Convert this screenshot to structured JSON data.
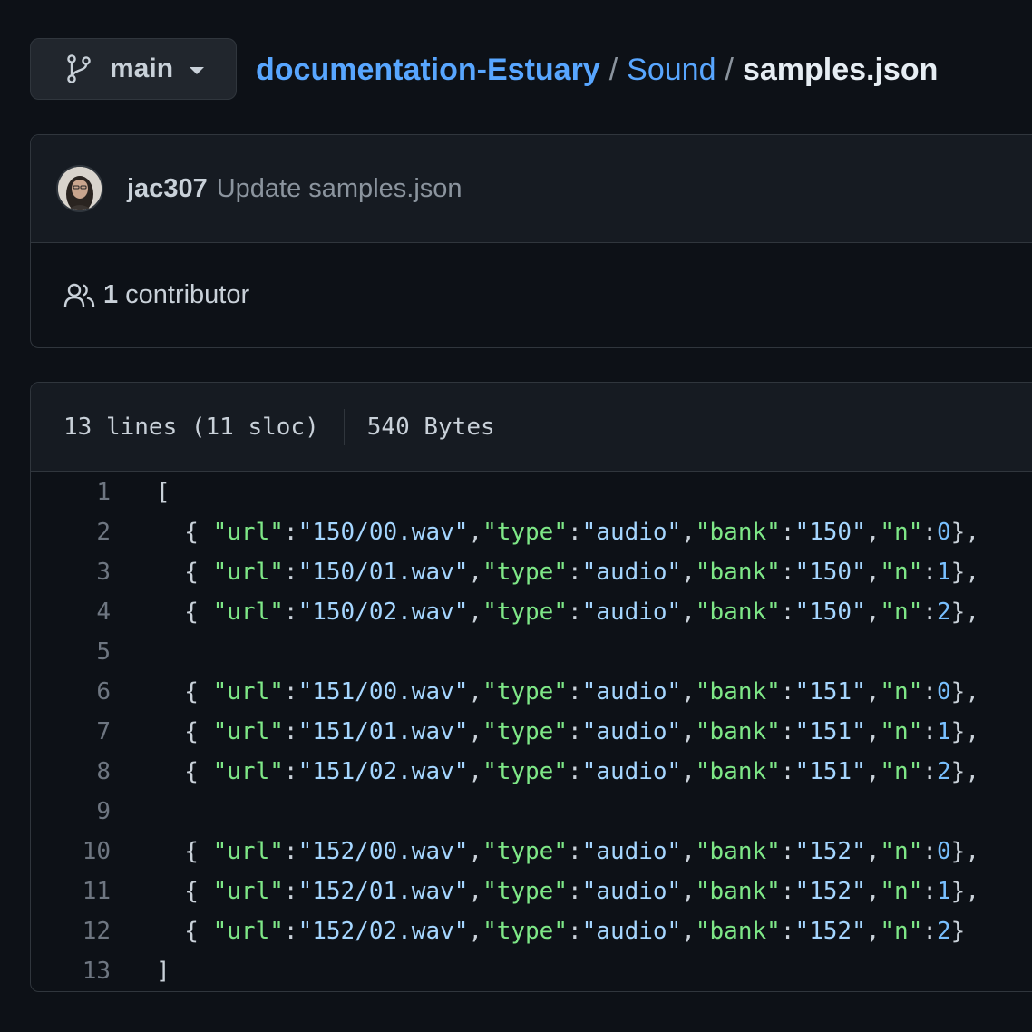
{
  "branch": {
    "name": "main",
    "icon": "git-branch-icon"
  },
  "breadcrumb": {
    "repo": "documentation-Estuary",
    "folder": "Sound",
    "file": "samples.json",
    "separator": "/"
  },
  "commit": {
    "author": "jac307",
    "message": "Update samples.json"
  },
  "contributors": {
    "count": "1",
    "label": "contributor"
  },
  "file_info": {
    "lines": "13 lines (11 sloc)",
    "size": "540 Bytes"
  },
  "code_lines": [
    {
      "num": "1",
      "tokens": [
        {
          "t": "p",
          "v": "["
        }
      ]
    },
    {
      "num": "2",
      "tokens": [
        {
          "t": "p",
          "v": "  { "
        },
        {
          "t": "k",
          "v": "\"url\""
        },
        {
          "t": "p",
          "v": ":"
        },
        {
          "t": "s",
          "v": "\"150/00.wav\""
        },
        {
          "t": "p",
          "v": ","
        },
        {
          "t": "k",
          "v": "\"type\""
        },
        {
          "t": "p",
          "v": ":"
        },
        {
          "t": "s",
          "v": "\"audio\""
        },
        {
          "t": "p",
          "v": ","
        },
        {
          "t": "k",
          "v": "\"bank\""
        },
        {
          "t": "p",
          "v": ":"
        },
        {
          "t": "s",
          "v": "\"150\""
        },
        {
          "t": "p",
          "v": ","
        },
        {
          "t": "k",
          "v": "\"n\""
        },
        {
          "t": "p",
          "v": ":"
        },
        {
          "t": "n",
          "v": "0"
        },
        {
          "t": "p",
          "v": "},"
        }
      ]
    },
    {
      "num": "3",
      "tokens": [
        {
          "t": "p",
          "v": "  { "
        },
        {
          "t": "k",
          "v": "\"url\""
        },
        {
          "t": "p",
          "v": ":"
        },
        {
          "t": "s",
          "v": "\"150/01.wav\""
        },
        {
          "t": "p",
          "v": ","
        },
        {
          "t": "k",
          "v": "\"type\""
        },
        {
          "t": "p",
          "v": ":"
        },
        {
          "t": "s",
          "v": "\"audio\""
        },
        {
          "t": "p",
          "v": ","
        },
        {
          "t": "k",
          "v": "\"bank\""
        },
        {
          "t": "p",
          "v": ":"
        },
        {
          "t": "s",
          "v": "\"150\""
        },
        {
          "t": "p",
          "v": ","
        },
        {
          "t": "k",
          "v": "\"n\""
        },
        {
          "t": "p",
          "v": ":"
        },
        {
          "t": "n",
          "v": "1"
        },
        {
          "t": "p",
          "v": "},"
        }
      ]
    },
    {
      "num": "4",
      "tokens": [
        {
          "t": "p",
          "v": "  { "
        },
        {
          "t": "k",
          "v": "\"url\""
        },
        {
          "t": "p",
          "v": ":"
        },
        {
          "t": "s",
          "v": "\"150/02.wav\""
        },
        {
          "t": "p",
          "v": ","
        },
        {
          "t": "k",
          "v": "\"type\""
        },
        {
          "t": "p",
          "v": ":"
        },
        {
          "t": "s",
          "v": "\"audio\""
        },
        {
          "t": "p",
          "v": ","
        },
        {
          "t": "k",
          "v": "\"bank\""
        },
        {
          "t": "p",
          "v": ":"
        },
        {
          "t": "s",
          "v": "\"150\""
        },
        {
          "t": "p",
          "v": ","
        },
        {
          "t": "k",
          "v": "\"n\""
        },
        {
          "t": "p",
          "v": ":"
        },
        {
          "t": "n",
          "v": "2"
        },
        {
          "t": "p",
          "v": "},"
        }
      ]
    },
    {
      "num": "5",
      "tokens": []
    },
    {
      "num": "6",
      "tokens": [
        {
          "t": "p",
          "v": "  { "
        },
        {
          "t": "k",
          "v": "\"url\""
        },
        {
          "t": "p",
          "v": ":"
        },
        {
          "t": "s",
          "v": "\"151/00.wav\""
        },
        {
          "t": "p",
          "v": ","
        },
        {
          "t": "k",
          "v": "\"type\""
        },
        {
          "t": "p",
          "v": ":"
        },
        {
          "t": "s",
          "v": "\"audio\""
        },
        {
          "t": "p",
          "v": ","
        },
        {
          "t": "k",
          "v": "\"bank\""
        },
        {
          "t": "p",
          "v": ":"
        },
        {
          "t": "s",
          "v": "\"151\""
        },
        {
          "t": "p",
          "v": ","
        },
        {
          "t": "k",
          "v": "\"n\""
        },
        {
          "t": "p",
          "v": ":"
        },
        {
          "t": "n",
          "v": "0"
        },
        {
          "t": "p",
          "v": "},"
        }
      ]
    },
    {
      "num": "7",
      "tokens": [
        {
          "t": "p",
          "v": "  { "
        },
        {
          "t": "k",
          "v": "\"url\""
        },
        {
          "t": "p",
          "v": ":"
        },
        {
          "t": "s",
          "v": "\"151/01.wav\""
        },
        {
          "t": "p",
          "v": ","
        },
        {
          "t": "k",
          "v": "\"type\""
        },
        {
          "t": "p",
          "v": ":"
        },
        {
          "t": "s",
          "v": "\"audio\""
        },
        {
          "t": "p",
          "v": ","
        },
        {
          "t": "k",
          "v": "\"bank\""
        },
        {
          "t": "p",
          "v": ":"
        },
        {
          "t": "s",
          "v": "\"151\""
        },
        {
          "t": "p",
          "v": ","
        },
        {
          "t": "k",
          "v": "\"n\""
        },
        {
          "t": "p",
          "v": ":"
        },
        {
          "t": "n",
          "v": "1"
        },
        {
          "t": "p",
          "v": "},"
        }
      ]
    },
    {
      "num": "8",
      "tokens": [
        {
          "t": "p",
          "v": "  { "
        },
        {
          "t": "k",
          "v": "\"url\""
        },
        {
          "t": "p",
          "v": ":"
        },
        {
          "t": "s",
          "v": "\"151/02.wav\""
        },
        {
          "t": "p",
          "v": ","
        },
        {
          "t": "k",
          "v": "\"type\""
        },
        {
          "t": "p",
          "v": ":"
        },
        {
          "t": "s",
          "v": "\"audio\""
        },
        {
          "t": "p",
          "v": ","
        },
        {
          "t": "k",
          "v": "\"bank\""
        },
        {
          "t": "p",
          "v": ":"
        },
        {
          "t": "s",
          "v": "\"151\""
        },
        {
          "t": "p",
          "v": ","
        },
        {
          "t": "k",
          "v": "\"n\""
        },
        {
          "t": "p",
          "v": ":"
        },
        {
          "t": "n",
          "v": "2"
        },
        {
          "t": "p",
          "v": "},"
        }
      ]
    },
    {
      "num": "9",
      "tokens": []
    },
    {
      "num": "10",
      "tokens": [
        {
          "t": "p",
          "v": "  { "
        },
        {
          "t": "k",
          "v": "\"url\""
        },
        {
          "t": "p",
          "v": ":"
        },
        {
          "t": "s",
          "v": "\"152/00.wav\""
        },
        {
          "t": "p",
          "v": ","
        },
        {
          "t": "k",
          "v": "\"type\""
        },
        {
          "t": "p",
          "v": ":"
        },
        {
          "t": "s",
          "v": "\"audio\""
        },
        {
          "t": "p",
          "v": ","
        },
        {
          "t": "k",
          "v": "\"bank\""
        },
        {
          "t": "p",
          "v": ":"
        },
        {
          "t": "s",
          "v": "\"152\""
        },
        {
          "t": "p",
          "v": ","
        },
        {
          "t": "k",
          "v": "\"n\""
        },
        {
          "t": "p",
          "v": ":"
        },
        {
          "t": "n",
          "v": "0"
        },
        {
          "t": "p",
          "v": "},"
        }
      ]
    },
    {
      "num": "11",
      "tokens": [
        {
          "t": "p",
          "v": "  { "
        },
        {
          "t": "k",
          "v": "\"url\""
        },
        {
          "t": "p",
          "v": ":"
        },
        {
          "t": "s",
          "v": "\"152/01.wav\""
        },
        {
          "t": "p",
          "v": ","
        },
        {
          "t": "k",
          "v": "\"type\""
        },
        {
          "t": "p",
          "v": ":"
        },
        {
          "t": "s",
          "v": "\"audio\""
        },
        {
          "t": "p",
          "v": ","
        },
        {
          "t": "k",
          "v": "\"bank\""
        },
        {
          "t": "p",
          "v": ":"
        },
        {
          "t": "s",
          "v": "\"152\""
        },
        {
          "t": "p",
          "v": ","
        },
        {
          "t": "k",
          "v": "\"n\""
        },
        {
          "t": "p",
          "v": ":"
        },
        {
          "t": "n",
          "v": "1"
        },
        {
          "t": "p",
          "v": "},"
        }
      ]
    },
    {
      "num": "12",
      "tokens": [
        {
          "t": "p",
          "v": "  { "
        },
        {
          "t": "k",
          "v": "\"url\""
        },
        {
          "t": "p",
          "v": ":"
        },
        {
          "t": "s",
          "v": "\"152/02.wav\""
        },
        {
          "t": "p",
          "v": ","
        },
        {
          "t": "k",
          "v": "\"type\""
        },
        {
          "t": "p",
          "v": ":"
        },
        {
          "t": "s",
          "v": "\"audio\""
        },
        {
          "t": "p",
          "v": ","
        },
        {
          "t": "k",
          "v": "\"bank\""
        },
        {
          "t": "p",
          "v": ":"
        },
        {
          "t": "s",
          "v": "\"152\""
        },
        {
          "t": "p",
          "v": ","
        },
        {
          "t": "k",
          "v": "\"n\""
        },
        {
          "t": "p",
          "v": ":"
        },
        {
          "t": "n",
          "v": "2"
        },
        {
          "t": "p",
          "v": "}"
        }
      ]
    },
    {
      "num": "13",
      "tokens": [
        {
          "t": "p",
          "v": "]"
        }
      ]
    }
  ],
  "colors": {
    "background": "#0d1117",
    "link": "#58a6ff",
    "json_key": "#7ee787",
    "json_string": "#a5d6ff",
    "json_number": "#79c0ff"
  }
}
